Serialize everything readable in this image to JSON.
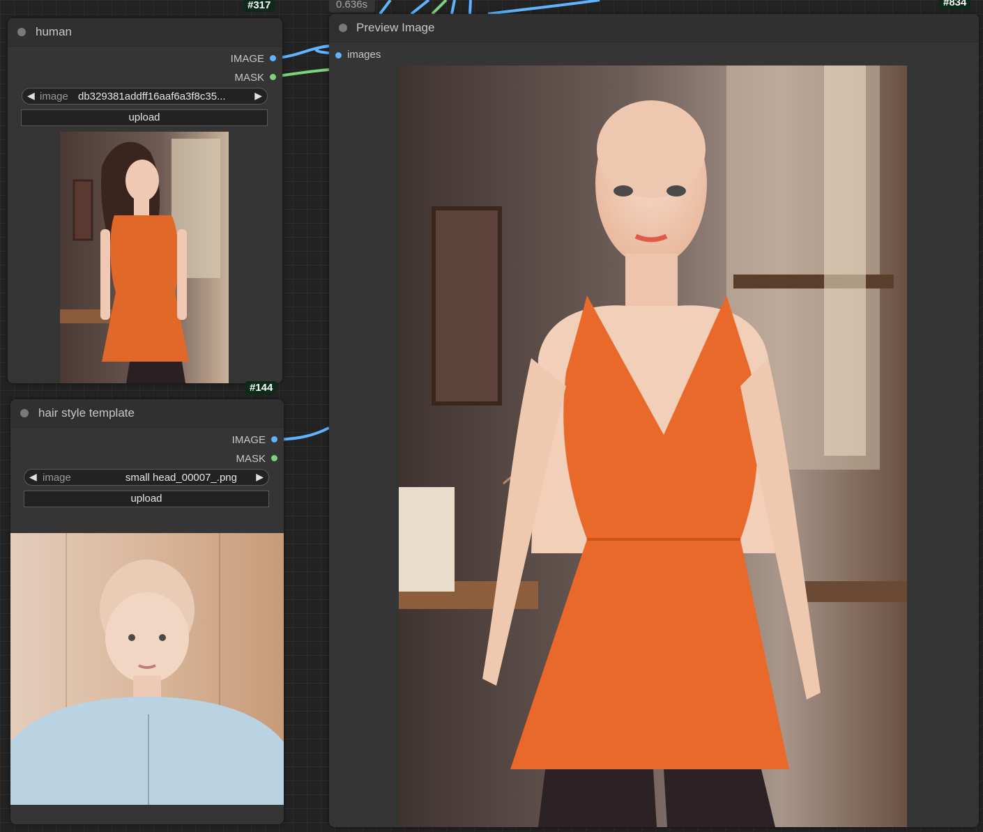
{
  "nodes": {
    "human": {
      "id": "#317",
      "title": "human",
      "outputs": [
        {
          "label": "IMAGE"
        },
        {
          "label": "MASK"
        }
      ],
      "image_widget": {
        "label": "image",
        "value": "db329381addff16aaf6a3f8c35..."
      },
      "upload_label": "upload",
      "preview_alt": "woman in orange dress"
    },
    "hair_template": {
      "id": "#144",
      "title": "hair style template",
      "outputs": [
        {
          "label": "IMAGE"
        },
        {
          "label": "MASK"
        }
      ],
      "image_widget": {
        "label": "image",
        "value": "small head_00007_.png"
      },
      "upload_label": "upload",
      "preview_alt": "bald person in light blue shirt"
    },
    "preview": {
      "id": "#834",
      "title": "Preview Image",
      "timing": "0.636s",
      "inputs": [
        {
          "label": "images"
        }
      ],
      "preview_alt": "bald woman in orange dress"
    }
  },
  "colors": {
    "image_port": "#5fb3ff",
    "mask_port": "#7cd37c",
    "node_bg": "#353535",
    "canvas_bg": "#222222",
    "id_badge": "#0c2a1a"
  },
  "icons": {
    "left_arrow": "◀",
    "right_arrow": "▶"
  }
}
